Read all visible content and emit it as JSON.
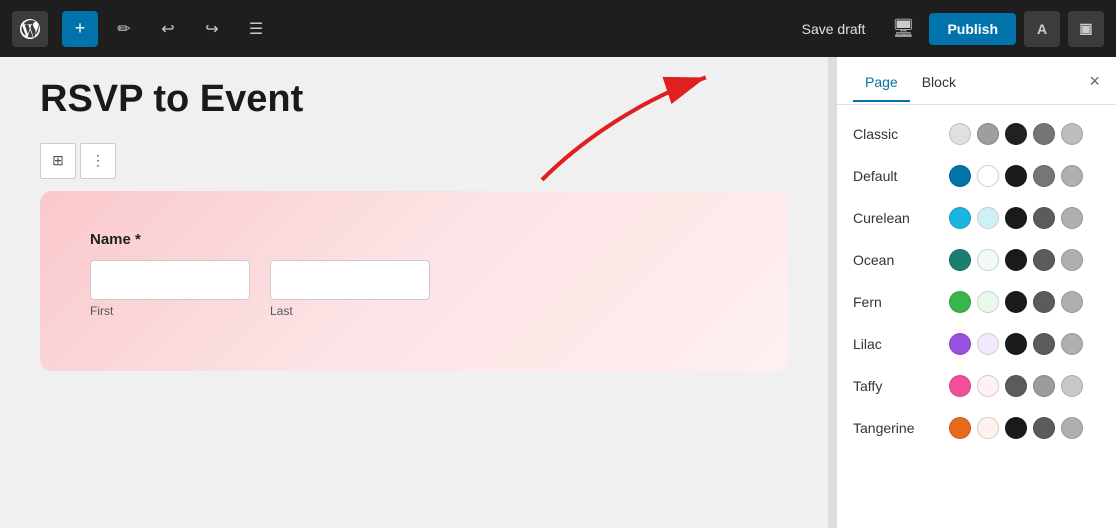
{
  "toolbar": {
    "save_draft_label": "Save draft",
    "publish_label": "Publish",
    "astra_label": "A",
    "undo_icon": "↩",
    "redo_icon": "↪",
    "list_view_icon": "≡",
    "plus_icon": "+",
    "pencil_icon": "✏"
  },
  "panel": {
    "tab_page": "Page",
    "tab_block": "Block",
    "close_icon": "×",
    "themes": [
      {
        "name": "Classic",
        "colors": [
          "#e0e0e0",
          "#9e9e9e",
          "#212121",
          "#757575",
          "#bdbdbd"
        ]
      },
      {
        "name": "Default",
        "colors": [
          "#0073aa",
          "#ffffff",
          "#1a1a1a",
          "#767676",
          "#b0b0b0"
        ]
      },
      {
        "name": "Curelean",
        "colors": [
          "#1ab5e2",
          "#d0f0f8",
          "#1a1a1a",
          "#5b5b5b",
          "#b0b0b0"
        ]
      },
      {
        "name": "Ocean",
        "colors": [
          "#1a7f6f",
          "#f0faf8",
          "#1a1a1a",
          "#5b5b5b",
          "#b0b0b0"
        ]
      },
      {
        "name": "Fern",
        "colors": [
          "#3ab54a",
          "#e8f9ea",
          "#1a1a1a",
          "#5b5b5b",
          "#b0b0b0"
        ]
      },
      {
        "name": "Lilac",
        "colors": [
          "#9b51e0",
          "#f3e8ff",
          "#1a1a1a",
          "#5b5b5b",
          "#b0b0b0"
        ]
      },
      {
        "name": "Taffy",
        "colors": [
          "#f0509a",
          "#fff0f5",
          "#5b5b5b",
          "#9b9b9b",
          "#c8c8c8"
        ]
      },
      {
        "name": "Tangerine",
        "colors": [
          "#e8691d",
          "#fef3ec",
          "#1a1a1a",
          "#5b5b5b",
          "#b0b0b0"
        ]
      }
    ]
  },
  "editor": {
    "page_title": "RSVP to Event",
    "form_label": "Name *",
    "first_placeholder": "First",
    "last_placeholder": "Last"
  }
}
